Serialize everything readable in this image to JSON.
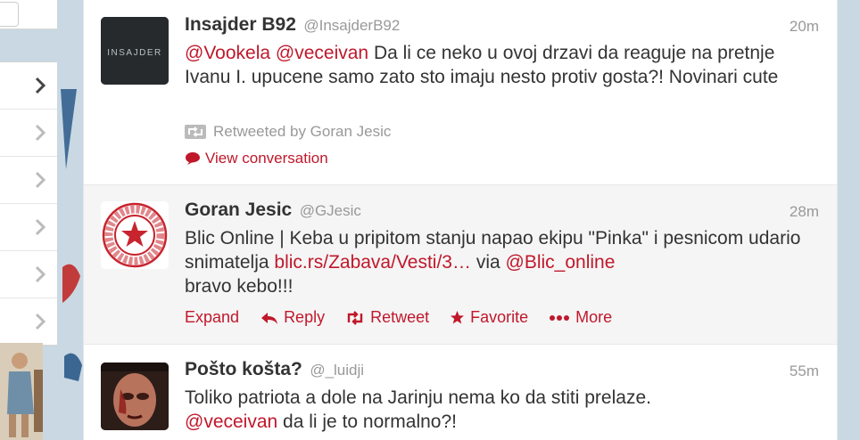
{
  "colors": {
    "link": "#c0182b",
    "meta": "#999999",
    "text": "#333333",
    "highlight": "#f5f5f5"
  },
  "tweets": [
    {
      "fullname": "Insajder B92",
      "screen_name": "@InsajderB92",
      "time": "20m",
      "avatar_icon": "insajder-logo",
      "text_parts": [
        "@Vookela",
        " ",
        "@veceivan",
        " Da li ce neko u ovoj drzavi da reaguje na pretnje Ivanu I. upucene samo zato sto imaju nesto protiv gosta?! Novinari cute"
      ],
      "retweeted_by": "Retweeted by Goran Jesic",
      "view_conversation": "View conversation"
    },
    {
      "fullname": "Goran Jesic",
      "screen_name": "@GJesic",
      "time": "28m",
      "avatar_icon": "red-star-seal",
      "text_parts": [
        "Blic Online | Keba u pripitom stanju napao ekipu \"Pinka\" i pesnicom udario snimatelja ",
        "blic.rs/Zabava/Vesti/3…",
        " via ",
        "@Blic_online",
        " bravo kebo!!!"
      ],
      "actions": {
        "expand": "Expand",
        "reply": "Reply",
        "retweet": "Retweet",
        "favorite": "Favorite",
        "more": "More"
      }
    },
    {
      "fullname": "Pošto košta?",
      "screen_name": "@_luidji",
      "time": "55m",
      "avatar_icon": "face-photo",
      "text_parts": [
        "Toliko patriota a dole na Jarinju nema ko da stiti prelaze. ",
        "@veceivan",
        " da li je to normalno?!"
      ]
    }
  ]
}
